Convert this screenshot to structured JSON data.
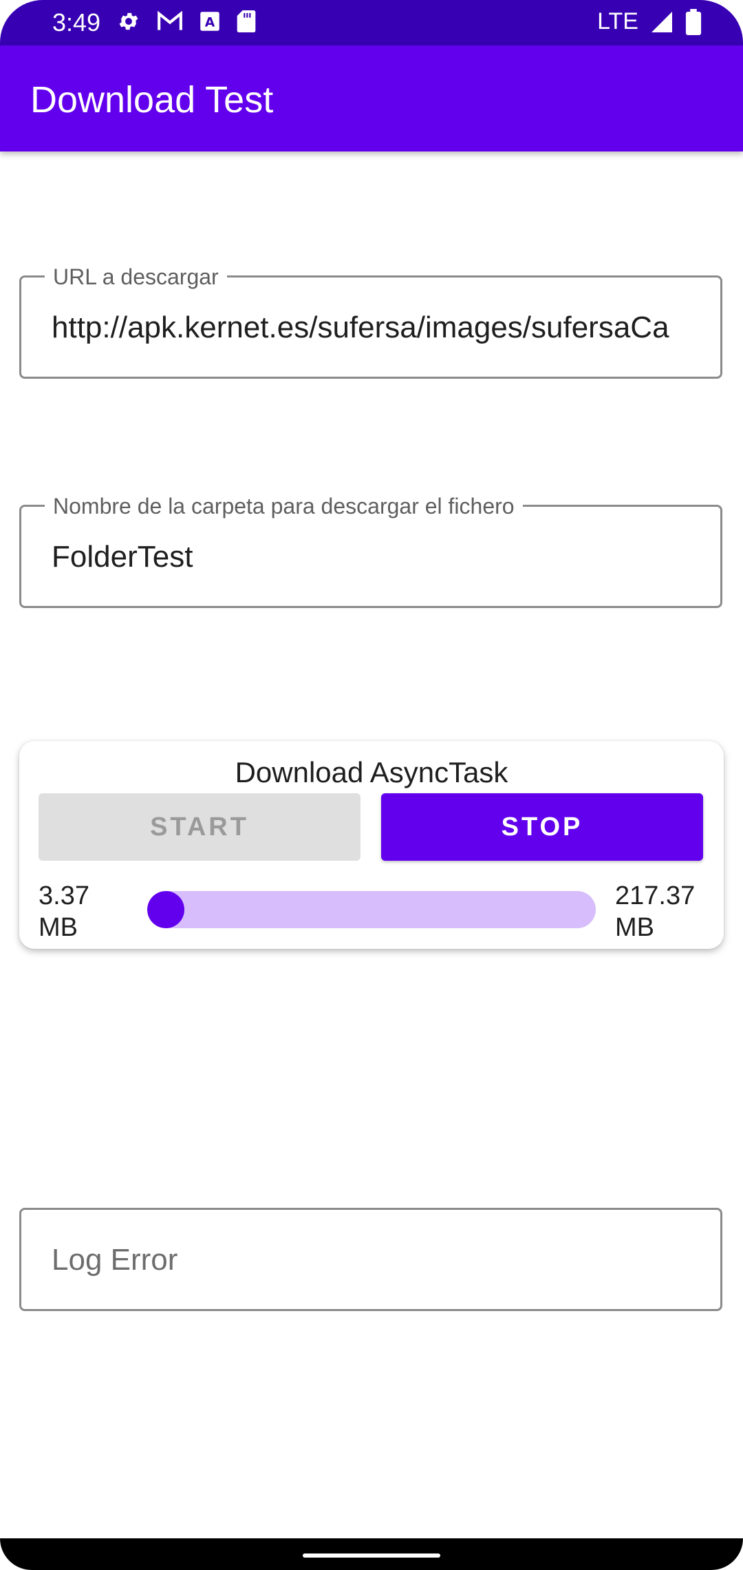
{
  "status_bar": {
    "time": "3:49",
    "network": "LTE"
  },
  "app": {
    "title": "Download Test",
    "accent": "#6200ee",
    "status_bar_color": "#3700b3"
  },
  "form": {
    "url": {
      "label": "URL a descargar",
      "value": "http://apk.kernet.es/sufersa/images/sufersaCa"
    },
    "folder": {
      "label": "Nombre de la carpeta para descargar el fichero",
      "value": "FolderTest"
    },
    "log": {
      "placeholder": "Log Error"
    }
  },
  "download_card": {
    "title": "Download AsyncTask",
    "start_label": "START",
    "stop_label": "STOP",
    "downloaded": "3.37",
    "downloaded_unit": "MB",
    "total": "217.37",
    "total_unit": "MB",
    "progress": 0.0155
  }
}
